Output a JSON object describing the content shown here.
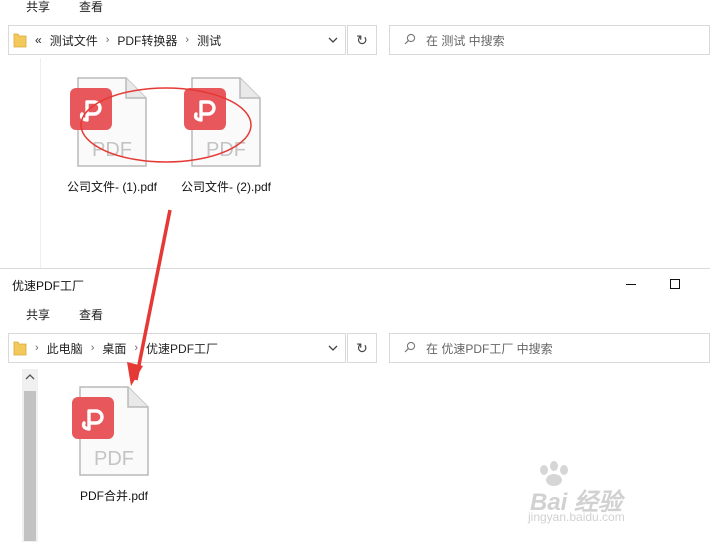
{
  "top_window": {
    "ribbon": {
      "share": "共享",
      "view": "查看"
    },
    "address": {
      "overflow": "«",
      "crumbs": [
        "测试文件",
        "PDF转换器",
        "测试"
      ]
    },
    "search": {
      "placeholder": "在 测试 中搜索"
    },
    "files": [
      {
        "name": "公司文件- (1).pdf",
        "badge": "PDF"
      },
      {
        "name": "公司文件- (2).pdf",
        "badge": "PDF"
      }
    ]
  },
  "bottom_window": {
    "title": "优速PDF工厂",
    "ribbon": {
      "share": "共享",
      "view": "查看"
    },
    "address": {
      "crumbs": [
        "此电脑",
        "桌面",
        "优速PDF工厂"
      ]
    },
    "search": {
      "placeholder": "在 优速PDF工厂 中搜索"
    },
    "files": [
      {
        "name": "PDF合并.pdf",
        "badge": "PDF"
      }
    ]
  },
  "watermark": {
    "brand": "Bai 经验",
    "url": "jingyan.baidu.com"
  },
  "colors": {
    "pdf_red": "#e8575b",
    "arrow_red": "#e53935",
    "border": "#d9d9d9"
  }
}
